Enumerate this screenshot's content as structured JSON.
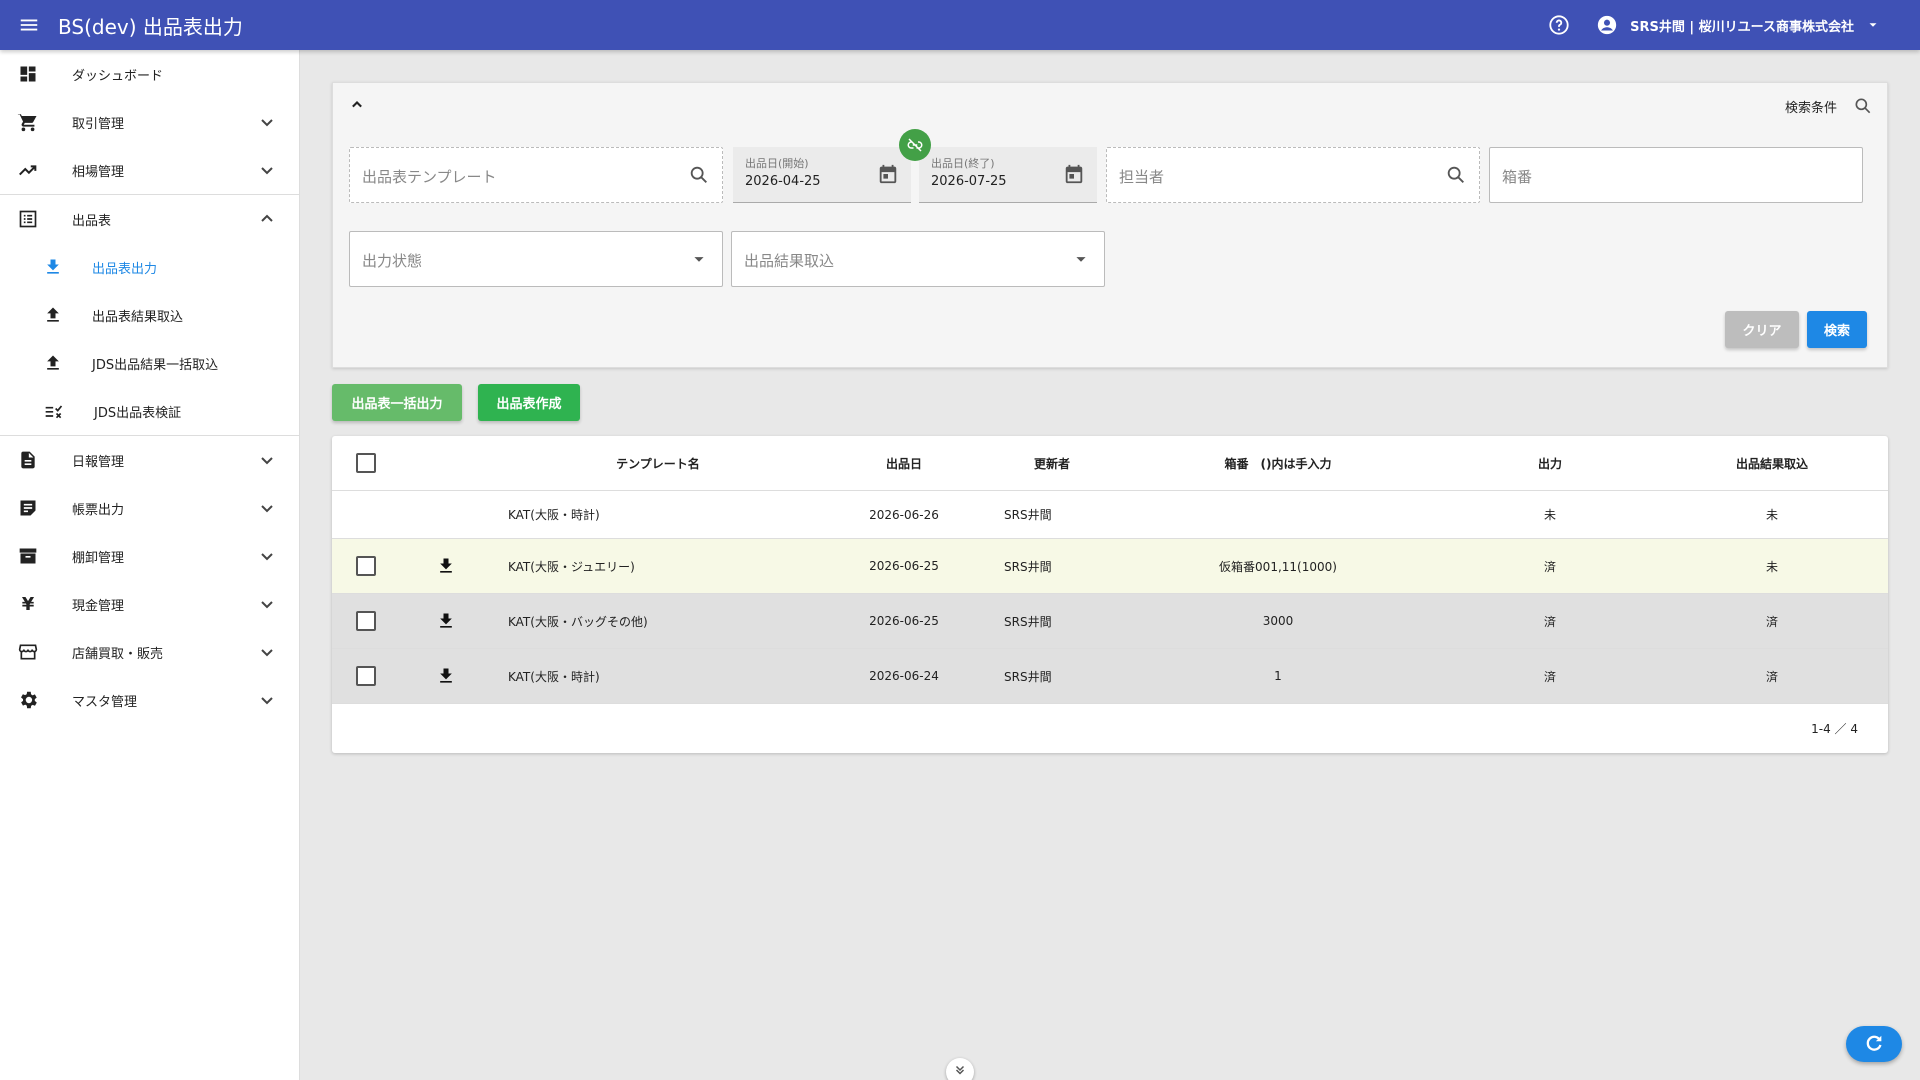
{
  "app": {
    "title": "BS(dev) 出品表出力",
    "account": "SRS井間 | 桜川リユース商事株式会社",
    "bar_color": "#3f51b5"
  },
  "sidebar": {
    "items": [
      {
        "label": "ダッシュボード",
        "icon": "dashboard-icon"
      },
      {
        "label": "取引管理",
        "icon": "cart-icon"
      },
      {
        "label": "相場管理",
        "icon": "trending-up-icon"
      },
      {
        "label": "出品表",
        "icon": "list-icon"
      },
      {
        "label": "日報管理",
        "icon": "document-icon"
      },
      {
        "label": "帳票出力",
        "icon": "note-icon"
      },
      {
        "label": "棚卸管理",
        "icon": "archive-icon"
      },
      {
        "label": "現金管理",
        "icon": "yen-icon"
      },
      {
        "label": "店舗買取・販売",
        "icon": "store-icon"
      },
      {
        "label": "マスタ管理",
        "icon": "gear-icon"
      }
    ],
    "subitems": [
      {
        "label": "出品表出力",
        "icon": "download-icon",
        "active": true
      },
      {
        "label": "出品表結果取込",
        "icon": "upload-icon"
      },
      {
        "label": "JDS出品結果一括取込",
        "icon": "upload-icon"
      },
      {
        "label": "JDS出品表検証",
        "icon": "checklist-icon"
      }
    ]
  },
  "search": {
    "header_label": "検索条件",
    "template_placeholder": "出品表テンプレート",
    "date_start_label": "出品日(開始)",
    "date_start_value": "2026-04-25",
    "date_end_label": "出品日(終了)",
    "date_end_value": "2026-07-25",
    "staff_placeholder": "担当者",
    "box_placeholder": "箱番",
    "output_status_placeholder": "出力状態",
    "result_import_placeholder": "出品結果取込",
    "clear_label": "クリア",
    "search_label": "検索"
  },
  "actions": {
    "bulk_output_label": "出品表一括出力",
    "create_label": "出品表作成"
  },
  "table": {
    "headers": {
      "name": "テンプレート名",
      "date": "出品日",
      "user": "更新者",
      "box": "箱番　()内は手入力",
      "output": "出力",
      "result": "出品結果取込"
    },
    "rows": [
      {
        "name": "KAT(大阪・時計)",
        "date": "2026-06-26",
        "user": "SRS井間",
        "box": "",
        "output": "未",
        "result": "未"
      },
      {
        "name": "KAT(大阪・ジュエリー)",
        "date": "2026-06-25",
        "user": "SRS井間",
        "box": "仮箱番001,11(1000)",
        "output": "済",
        "result": "未"
      },
      {
        "name": "KAT(大阪・バッグその他)",
        "date": "2026-06-25",
        "user": "SRS井間",
        "box": "3000",
        "output": "済",
        "result": "済"
      },
      {
        "name": "KAT(大阪・時計)",
        "date": "2026-06-24",
        "user": "SRS井間",
        "box": "1",
        "output": "済",
        "result": "済"
      }
    ],
    "pagination": "1-4 ／ 4"
  }
}
